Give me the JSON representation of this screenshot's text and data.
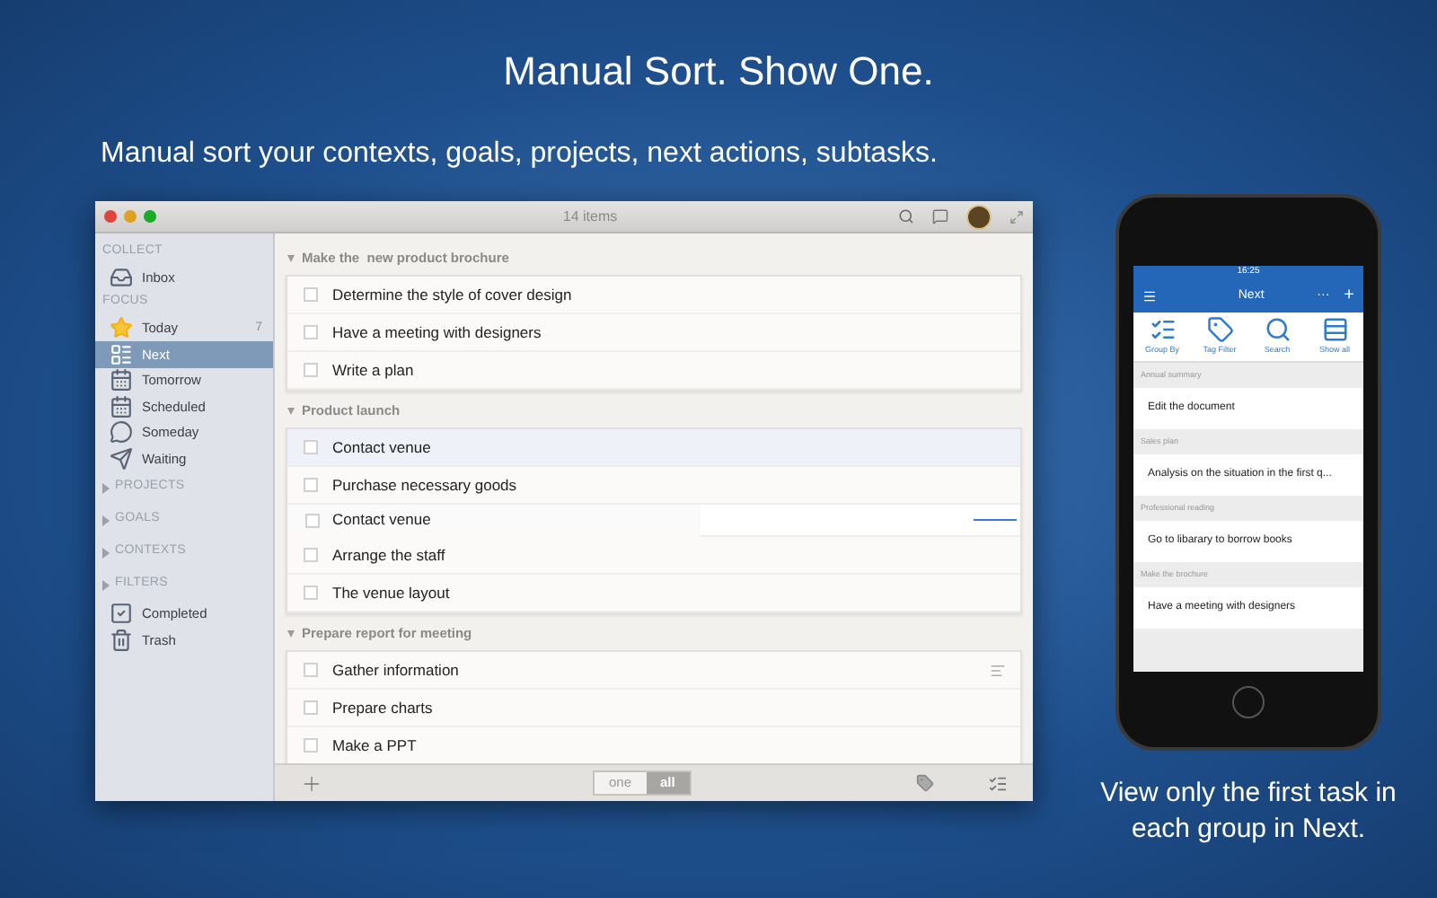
{
  "headline": "Manual Sort. Show One.",
  "subtitle": "Manual sort your contexts, goals, projects, next actions, subtasks.",
  "window": {
    "title": "14 items"
  },
  "sidebar": {
    "sections": [
      {
        "kind": "header",
        "label": "COLLECT",
        "items": [
          {
            "label": "Inbox",
            "kind": "inbox",
            "selected": false
          }
        ]
      },
      {
        "kind": "header",
        "label": "FOCUS",
        "items": [
          {
            "label": "Today",
            "kind": "star",
            "count": "7",
            "selected": false
          },
          {
            "label": "Next",
            "kind": "next",
            "selected": true
          },
          {
            "label": "Tomorrow",
            "kind": "calendar",
            "selected": false
          },
          {
            "label": "Scheduled",
            "kind": "calendar",
            "selected": false
          },
          {
            "label": "Someday",
            "kind": "bubble",
            "selected": false
          },
          {
            "label": "Waiting",
            "kind": "plane",
            "selected": false
          }
        ]
      },
      {
        "kind": "collapsed",
        "label": "PROJECTS"
      },
      {
        "kind": "collapsed",
        "label": "GOALS"
      },
      {
        "kind": "collapsed",
        "label": "CONTEXTS"
      },
      {
        "kind": "collapsed",
        "label": "FILTERS",
        "items": [
          {
            "label": "Completed",
            "kind": "check",
            "selected": false
          },
          {
            "label": "Trash",
            "kind": "trash",
            "selected": false
          }
        ]
      }
    ]
  },
  "groups": [
    {
      "title": "Make the  new product brochure",
      "tasks": [
        {
          "label": "Determine the style of cover design",
          "selected": false
        },
        {
          "label": "Have a meeting with designers",
          "selected": false
        },
        {
          "label": "Write a plan",
          "selected": false
        }
      ]
    },
    {
      "title": "Product launch",
      "tasks": [
        {
          "label": "Contact venue",
          "selected": true
        },
        {
          "label": "Purchase necessary goods",
          "selected": false
        },
        {
          "label": "Arrange the staff",
          "selected": false
        },
        {
          "label": "The venue layout",
          "selected": false
        }
      ]
    },
    {
      "title": "Prepare report for meeting",
      "tasks": [
        {
          "label": "Gather information",
          "selected": false,
          "note": true
        },
        {
          "label": "Prepare charts",
          "selected": false
        },
        {
          "label": "Make a PPT",
          "selected": false
        }
      ]
    }
  ],
  "drag_ghost": {
    "label": "Contact venue",
    "checked": false
  },
  "bottom_bar": {
    "segments": [
      {
        "label": "one",
        "selected": false
      },
      {
        "label": "all",
        "selected": true
      }
    ]
  },
  "phone": {
    "time": "16:25",
    "title": "Next",
    "more": "···",
    "add": "+",
    "tools": [
      {
        "label": "Group By",
        "kind": "group"
      },
      {
        "label": "Tag Filter",
        "kind": "tag"
      },
      {
        "label": "Search",
        "kind": "search"
      },
      {
        "label": "Show all",
        "kind": "list"
      }
    ],
    "groups": [
      {
        "title": "Annual summary",
        "task": "Edit the document"
      },
      {
        "title": "Sales plan",
        "task": "Analysis on the situation in the first q..."
      },
      {
        "title": "Professional reading",
        "task": "Go to libarary to borrow books"
      },
      {
        "title": "Make the brochure",
        "task": "Have a meeting with designers"
      }
    ]
  },
  "caption": "View only the first task in each group in Next."
}
